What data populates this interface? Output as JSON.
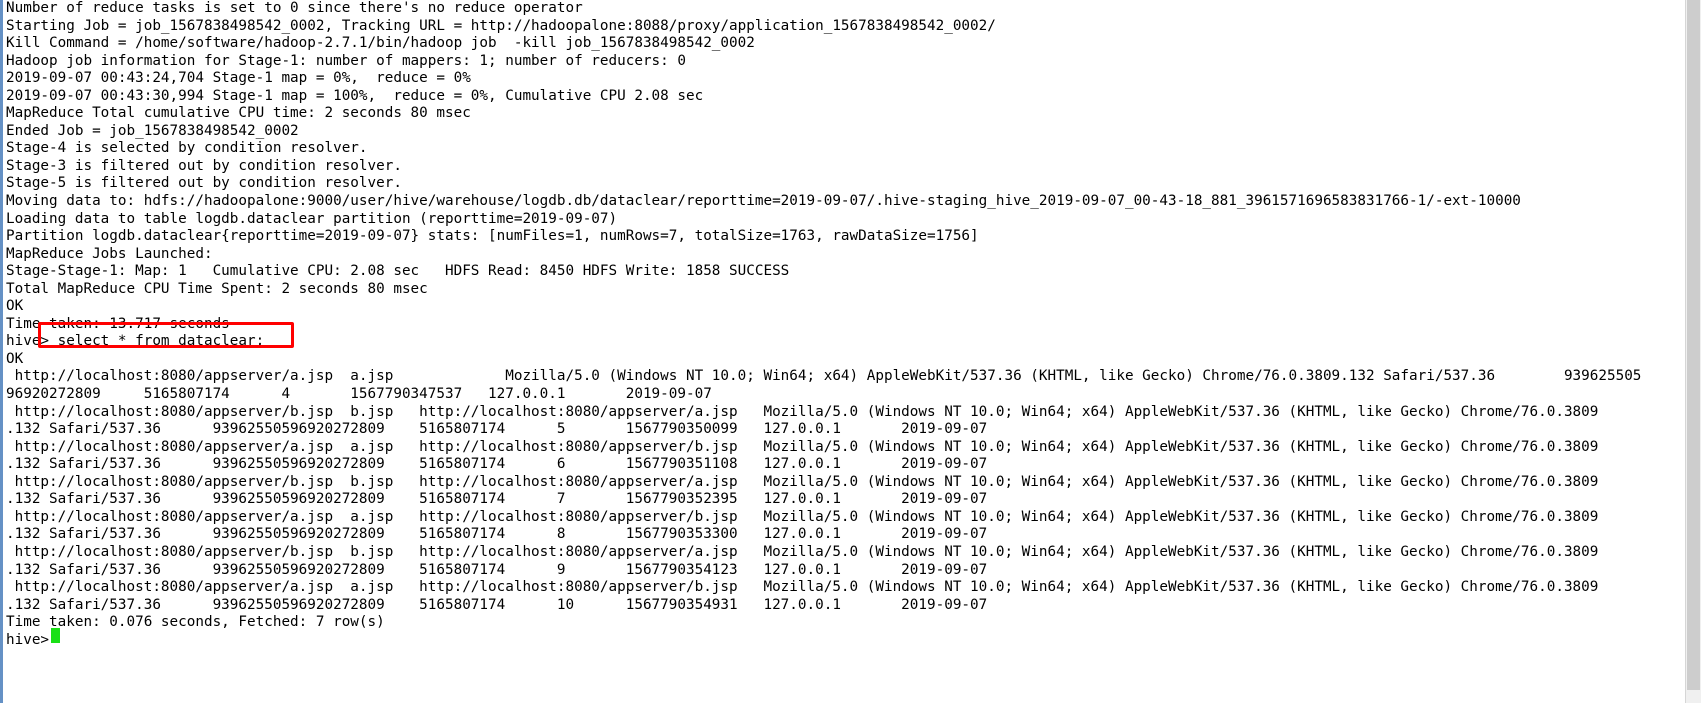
{
  "terminal": {
    "prompt": "hive>",
    "cursor_color": "#19e016",
    "annotation_color": "#ff0000",
    "highlighted_command": "hive> select * from dataclear;",
    "lines": [
      "Number of reduce tasks is set to 0 since there's no reduce operator",
      "Starting Job = job_1567838498542_0002, Tracking URL = http://hadoopalone:8088/proxy/application_1567838498542_0002/",
      "Kill Command = /home/software/hadoop-2.7.1/bin/hadoop job  -kill job_1567838498542_0002",
      "Hadoop job information for Stage-1: number of mappers: 1; number of reducers: 0",
      "2019-09-07 00:43:24,704 Stage-1 map = 0%,  reduce = 0%",
      "2019-09-07 00:43:30,994 Stage-1 map = 100%,  reduce = 0%, Cumulative CPU 2.08 sec",
      "MapReduce Total cumulative CPU time: 2 seconds 80 msec",
      "Ended Job = job_1567838498542_0002",
      "Stage-4 is selected by condition resolver.",
      "Stage-3 is filtered out by condition resolver.",
      "Stage-5 is filtered out by condition resolver.",
      "Moving data to: hdfs://hadoopalone:9000/user/hive/warehouse/logdb.db/dataclear/reporttime=2019-09-07/.hive-staging_hive_2019-09-07_00-43-18_881_3961571696583831766-1/-ext-10000",
      "Loading data to table logdb.dataclear partition (reporttime=2019-09-07)",
      "Partition logdb.dataclear{reporttime=2019-09-07} stats: [numFiles=1, numRows=7, totalSize=1763, rawDataSize=1756]",
      "MapReduce Jobs Launched:",
      "Stage-Stage-1: Map: 1   Cumulative CPU: 2.08 sec   HDFS Read: 8450 HDFS Write: 1858 SUCCESS",
      "Total MapReduce CPU Time Spent: 2 seconds 80 msec",
      "OK",
      "Time taken: 13.717 seconds",
      "hive> select * from dataclear;",
      "OK",
      " http://localhost:8080/appserver/a.jsp  a.jsp             Mozilla/5.0 (Windows NT 10.0; Win64; x64) AppleWebKit/537.36 (KHTML, like Gecko) Chrome/76.0.3809.132 Safari/537.36        939625505",
      "96920272809     5165807174      4       1567790347537   127.0.0.1       2019-09-07",
      " http://localhost:8080/appserver/b.jsp  b.jsp   http://localhost:8080/appserver/a.jsp   Mozilla/5.0 (Windows NT 10.0; Win64; x64) AppleWebKit/537.36 (KHTML, like Gecko) Chrome/76.0.3809",
      ".132 Safari/537.36      93962550596920272809    5165807174      5       1567790350099   127.0.0.1       2019-09-07",
      " http://localhost:8080/appserver/a.jsp  a.jsp   http://localhost:8080/appserver/b.jsp   Mozilla/5.0 (Windows NT 10.0; Win64; x64) AppleWebKit/537.36 (KHTML, like Gecko) Chrome/76.0.3809",
      ".132 Safari/537.36      93962550596920272809    5165807174      6       1567790351108   127.0.0.1       2019-09-07",
      " http://localhost:8080/appserver/b.jsp  b.jsp   http://localhost:8080/appserver/a.jsp   Mozilla/5.0 (Windows NT 10.0; Win64; x64) AppleWebKit/537.36 (KHTML, like Gecko) Chrome/76.0.3809",
      ".132 Safari/537.36      93962550596920272809    5165807174      7       1567790352395   127.0.0.1       2019-09-07",
      " http://localhost:8080/appserver/a.jsp  a.jsp   http://localhost:8080/appserver/b.jsp   Mozilla/5.0 (Windows NT 10.0; Win64; x64) AppleWebKit/537.36 (KHTML, like Gecko) Chrome/76.0.3809",
      ".132 Safari/537.36      93962550596920272809    5165807174      8       1567790353300   127.0.0.1       2019-09-07",
      " http://localhost:8080/appserver/b.jsp  b.jsp   http://localhost:8080/appserver/a.jsp   Mozilla/5.0 (Windows NT 10.0; Win64; x64) AppleWebKit/537.36 (KHTML, like Gecko) Chrome/76.0.3809",
      ".132 Safari/537.36      93962550596920272809    5165807174      9       1567790354123   127.0.0.1       2019-09-07",
      " http://localhost:8080/appserver/a.jsp  a.jsp   http://localhost:8080/appserver/b.jsp   Mozilla/5.0 (Windows NT 10.0; Win64; x64) AppleWebKit/537.36 (KHTML, like Gecko) Chrome/76.0.3809",
      ".132 Safari/537.36      93962550596920272809    5165807174      10      1567790354931   127.0.0.1       2019-09-07",
      "Time taken: 0.076 seconds, Fetched: 7 row(s)",
      "hive> "
    ]
  }
}
